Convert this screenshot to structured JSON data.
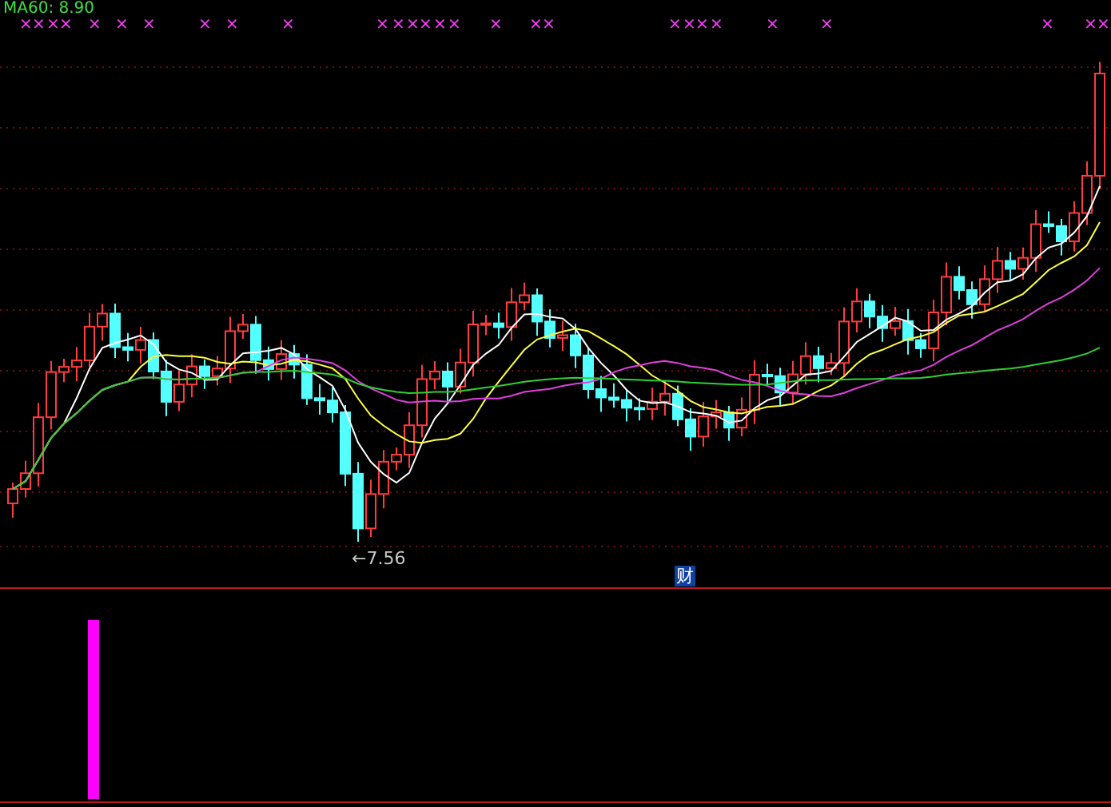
{
  "indicator": {
    "label": "MA60: 8.90"
  },
  "signal_marks": {
    "symbol": "×"
  },
  "low_label": "←7.56",
  "finance_badge": "财"
}
